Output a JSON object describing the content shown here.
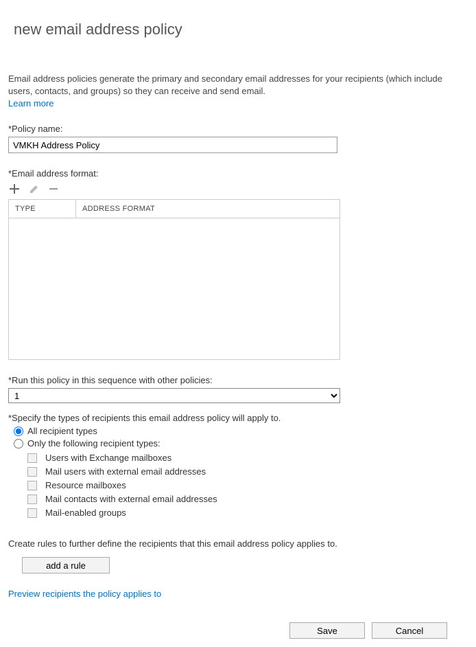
{
  "title": "new email address policy",
  "description": "Email address policies generate the primary and secondary email addresses for your recipients (which include users, contacts, and groups) so they can receive and send email.",
  "learn_more": "Learn more",
  "policy_name": {
    "label": "*Policy name:",
    "value": "VMKH Address Policy"
  },
  "email_format": {
    "label": "*Email address format:",
    "headers": {
      "type": "TYPE",
      "address": "ADDRESS FORMAT"
    },
    "rows": []
  },
  "sequence": {
    "label": "*Run this policy in this sequence with other policies:",
    "value": "1",
    "options": [
      "1"
    ]
  },
  "recipient_types": {
    "label": "*Specify the types of recipients this email address policy will apply to.",
    "all_label": "All recipient types",
    "only_label": "Only the following recipient types:",
    "selected": "all",
    "types": [
      "Users with Exchange mailboxes",
      "Mail users with external email addresses",
      "Resource mailboxes",
      "Mail contacts with external email addresses",
      "Mail-enabled groups"
    ]
  },
  "rules": {
    "label": "Create rules to further define the recipients that this email address policy applies to.",
    "button": "add a rule"
  },
  "preview_link": "Preview recipients the policy applies to",
  "buttons": {
    "save": "Save",
    "cancel": "Cancel"
  }
}
